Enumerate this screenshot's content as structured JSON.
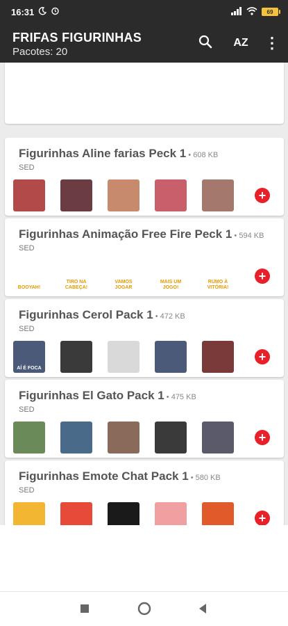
{
  "status": {
    "time": "16:31",
    "battery": "69"
  },
  "header": {
    "title": "FRIFAS FIGURINHAS",
    "subtitle": "Pacotes: 20",
    "sort_label": "AZ",
    "more_label": "⋮"
  },
  "packs": [
    {
      "name": "Figurinhas Aline farias Peck 1",
      "size": " • 608 KB",
      "author": "SED",
      "stickers": [
        {
          "caption": "",
          "color": "#b34a4a"
        },
        {
          "caption": "",
          "color": "#6b3c42"
        },
        {
          "caption": "",
          "color": "#c78a6d"
        },
        {
          "caption": "",
          "color": "#c85f6a"
        },
        {
          "caption": "",
          "color": "#a5786e"
        }
      ]
    },
    {
      "name": "Figurinhas Animação Free Fire Peck 1",
      "size": " • 594 KB",
      "author": "SED",
      "stickers": [
        {
          "caption": "BOOYAH!",
          "color": "#ffffff"
        },
        {
          "caption": "TIRO NA CABEÇA!",
          "color": "#ffffff"
        },
        {
          "caption": "VAMOS JOGAR",
          "color": "#ffffff"
        },
        {
          "caption": "MAIS UM JOGO!",
          "color": "#ffffff"
        },
        {
          "caption": "RUMO À VITÓRIA!",
          "color": "#ffffff"
        }
      ]
    },
    {
      "name": "Figurinhas Cerol Pack 1",
      "size": " • 472 KB",
      "author": "SED",
      "stickers": [
        {
          "caption": "AÍ É FOCA",
          "color": "#4a5a78"
        },
        {
          "caption": "",
          "color": "#3a3a3a"
        },
        {
          "caption": "",
          "color": "#d9d9d9"
        },
        {
          "caption": "",
          "color": "#4a5a78"
        },
        {
          "caption": "",
          "color": "#7a3a3a"
        }
      ]
    },
    {
      "name": "Figurinhas El Gato Pack 1",
      "size": " • 475 KB",
      "author": "SED",
      "stickers": [
        {
          "caption": "",
          "color": "#6a8a5a"
        },
        {
          "caption": "",
          "color": "#4a6a8a"
        },
        {
          "caption": "",
          "color": "#8a6a5a"
        },
        {
          "caption": "",
          "color": "#3a3a3a"
        },
        {
          "caption": "",
          "color": "#5a5a6a"
        }
      ]
    },
    {
      "name": "Figurinhas Emote Chat Pack 1",
      "size": " • 580 KB",
      "author": "SED",
      "stickers": [
        {
          "caption": "",
          "color": "#f2b632"
        },
        {
          "caption": "",
          "color": "#e84a3a"
        },
        {
          "caption": "",
          "color": "#1a1a1a"
        },
        {
          "caption": "",
          "color": "#f0a0a0"
        },
        {
          "caption": "",
          "color": "#e05a2a"
        }
      ]
    }
  ]
}
